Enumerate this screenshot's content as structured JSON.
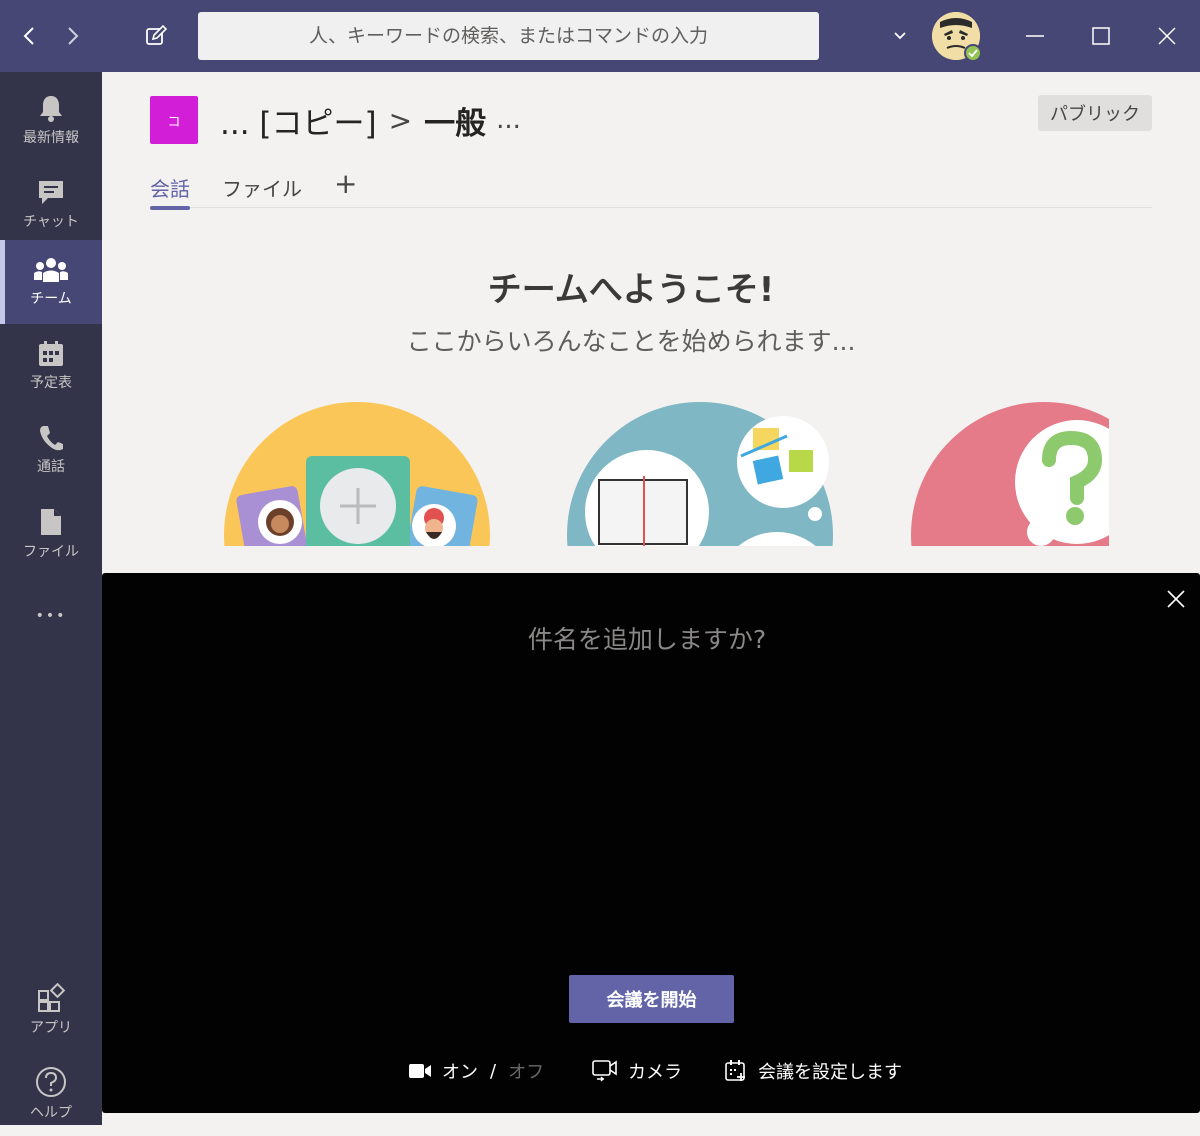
{
  "titlebar": {
    "search_placeholder": "人、キーワードの検索、またはコマンドの入力"
  },
  "appbar": {
    "items": [
      {
        "label": "最新情報",
        "icon": "bell-icon"
      },
      {
        "label": "チャット",
        "icon": "chat-icon"
      },
      {
        "label": "チーム",
        "icon": "teams-icon"
      },
      {
        "label": "予定表",
        "icon": "calendar-icon"
      },
      {
        "label": "通話",
        "icon": "phone-icon"
      },
      {
        "label": "ファイル",
        "icon": "file-icon"
      }
    ],
    "more_label": "•••",
    "bottom_items": [
      {
        "label": "アプリ",
        "icon": "apps-icon"
      },
      {
        "label": "ヘルプ",
        "icon": "help-icon"
      }
    ]
  },
  "channel": {
    "team_tile_letter": "コ",
    "team_tile_color": "#d21ed7",
    "team_name": "... [コピー]",
    "separator": ">",
    "channel_name": "一般",
    "more": "...",
    "visibility_badge": "パブリック"
  },
  "tabs": [
    {
      "label": "会話",
      "active": true
    },
    {
      "label": "ファイル",
      "active": false
    },
    {
      "label": "+",
      "active": false
    }
  ],
  "welcome": {
    "title": "チームへようこそ!",
    "subtitle": "ここからいろんなことを始められます..."
  },
  "meeting": {
    "subject_placeholder": "件名を追加しますか?",
    "start_button": "会議を開始",
    "video_on": "オン",
    "video_slash": "/",
    "video_off": "オフ",
    "camera_label": "カメラ",
    "schedule_label": "会議を設定します"
  },
  "colors": {
    "titlebar": "#464775",
    "appbar": "#33344a",
    "accent": "#6264a7",
    "presence": "#92c353"
  }
}
